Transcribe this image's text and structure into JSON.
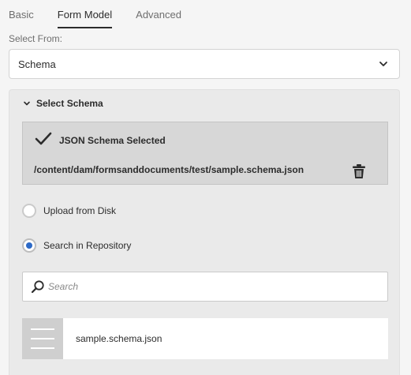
{
  "tabs": [
    {
      "label": "Basic",
      "active": false
    },
    {
      "label": "Form Model",
      "active": true
    },
    {
      "label": "Advanced",
      "active": false
    }
  ],
  "select_from": {
    "label": "Select From:",
    "value": "Schema"
  },
  "section": {
    "title": "Select Schema"
  },
  "selected": {
    "title": "JSON Schema Selected",
    "path": "/content/dam/formsanddocuments/test/sample.schema.json"
  },
  "radios": [
    {
      "label": "Upload from Disk",
      "checked": false
    },
    {
      "label": "Search in Repository",
      "checked": true
    }
  ],
  "search": {
    "placeholder": "Search",
    "value": ""
  },
  "results": [
    {
      "name": "sample.schema.json",
      "icon": "document-lines-icon"
    }
  ],
  "colors": {
    "accent": "#2d6ac7",
    "panel": "#eaeaea",
    "selected_bg": "#d7d7d7"
  }
}
